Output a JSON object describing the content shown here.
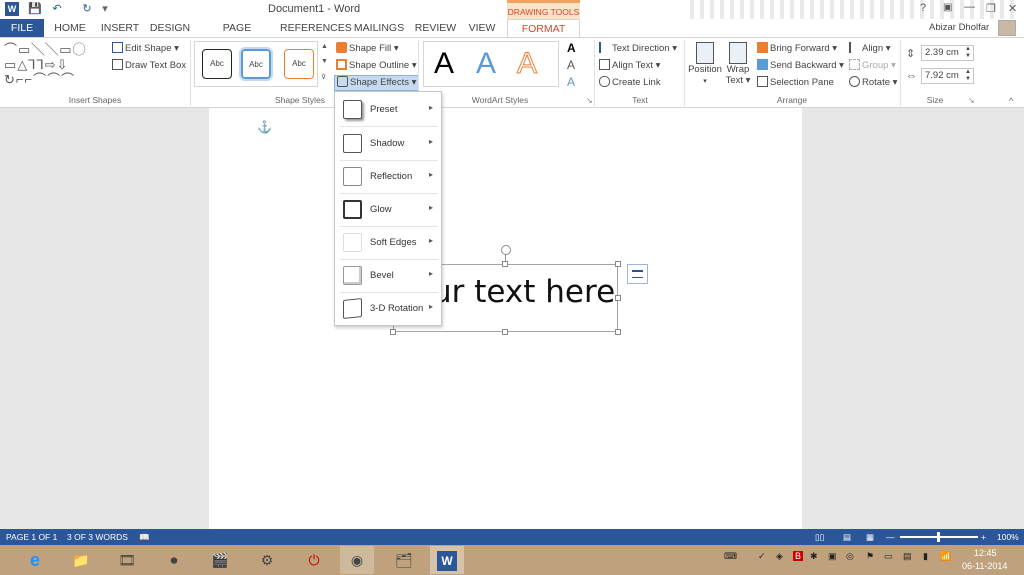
{
  "window": {
    "title": "Document1 - Word",
    "help": "?",
    "minimize": "—",
    "restore": "❐",
    "close": "✕",
    "user": "Abizar Dholfar"
  },
  "quick_access": {
    "save": "💾",
    "undo": "↶",
    "redo": "↻",
    "customize": "▾"
  },
  "tabs": {
    "file": "FILE",
    "home": "HOME",
    "insert": "INSERT",
    "design": "DESIGN",
    "page_layout": "PAGE LAYOUT",
    "references": "REFERENCES",
    "mailings": "MAILINGS",
    "review": "REVIEW",
    "view": "VIEW",
    "contextual_group": "DRAWING TOOLS",
    "format": "FORMAT"
  },
  "ribbon": {
    "insert_shapes": {
      "edit_shape": "Edit Shape",
      "draw_text_box": "Draw Text Box",
      "label": "Insert Shapes"
    },
    "shape_styles": {
      "style_text": "Abc",
      "shape_fill": "Shape Fill",
      "shape_outline": "Shape Outline",
      "shape_effects": "Shape Effects",
      "label": "Shape Styles"
    },
    "wordart": {
      "letter": "A",
      "label": "WordArt Styles"
    },
    "text": {
      "text_direction": "Text Direction",
      "align_text": "Align Text",
      "create_link": "Create Link",
      "label": "Text"
    },
    "arrange": {
      "position": "Position",
      "wrap": "Wrap",
      "text": "Text",
      "bring_forward": "Bring Forward",
      "send_backward": "Send Backward",
      "selection_pane": "Selection Pane",
      "align": "Align",
      "group": "Group",
      "rotate": "Rotate",
      "label": "Arrange"
    },
    "size": {
      "height": "2.39 cm",
      "width": "7.92 cm",
      "label": "Size"
    }
  },
  "document": {
    "textbox_text": "ur text here",
    "anchor": "⚓"
  },
  "shape_effects_menu": [
    {
      "label": "Preset"
    },
    {
      "label": "Shadow"
    },
    {
      "label": "Reflection"
    },
    {
      "label": "Glow"
    },
    {
      "label": "Soft Edges"
    },
    {
      "label": "Bevel"
    },
    {
      "label": "3-D Rotation"
    }
  ],
  "status_bar": {
    "page": "PAGE 1 OF 1",
    "words": "3 OF 3 WORDS",
    "zoom": "100%"
  },
  "taskbar": {
    "time": "12:45",
    "date": "06-11-2014"
  },
  "colors": {
    "word_blue": "#2b579a",
    "format_orange": "#d24726",
    "taskbar": "#bfa27d"
  }
}
